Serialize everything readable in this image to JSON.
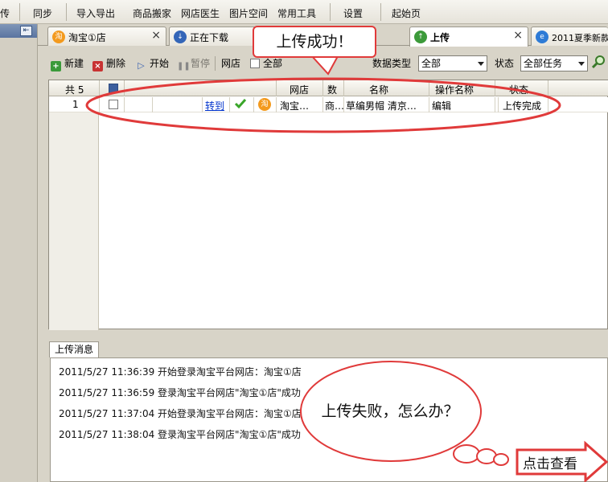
{
  "menu": {
    "items": [
      "传",
      "同步",
      "导入导出",
      "商品搬家",
      "网店医生",
      "图片空间",
      "常用工具",
      "设置",
      "起始页"
    ]
  },
  "tabs": [
    {
      "label": "淘宝①店",
      "icon": "taobao-icon"
    },
    {
      "label": "正在下载",
      "icon": "download-icon"
    },
    {
      "label": "上传",
      "icon": "upload-icon"
    },
    {
      "label": "2011夏季新款",
      "icon": "ie-browser-icon"
    }
  ],
  "toolbar": {
    "new_label": "新建",
    "delete_label": "删除",
    "start_label": "开始",
    "pause_label": "暂停",
    "shop_label": "网店",
    "shop_checkbox_label": "全部",
    "datatype_label": "数据类型",
    "datatype_value": "全部",
    "status_label": "状态",
    "status_value": "全部任务"
  },
  "grid": {
    "count_label": "共 5",
    "headers": {
      "shop": "网店",
      "qty": "数",
      "name": "名称",
      "operation": "操作名称",
      "status": "状态"
    },
    "rows": [
      {
        "num": "1",
        "link": "转到",
        "shop": "淘宝…",
        "qty": "商…",
        "name": "草编男帽 清京…",
        "operation": "编辑",
        "status": "上传完成"
      }
    ]
  },
  "messages": {
    "tab_label": "上传消息",
    "lines": [
      "2011/5/27 11:36:39 开始登录淘宝平台网店：淘宝①店",
      "2011/5/27 11:36:59 登录淘宝平台网店\"淘宝①店\"成功",
      "2011/5/27 11:37:04 开始登录淘宝平台网店：淘宝①店",
      "2011/5/27 11:38:04 登录淘宝平台网店\"淘宝①店\"成功"
    ]
  },
  "annotations": {
    "top_callout": "上传成功！",
    "bubble_text": "上传失败，怎么办？",
    "view_button": "点击查看"
  },
  "colors": {
    "accent_red": "#e03a3a",
    "link_blue": "#0033cc",
    "check_green": "#3aa62a"
  }
}
